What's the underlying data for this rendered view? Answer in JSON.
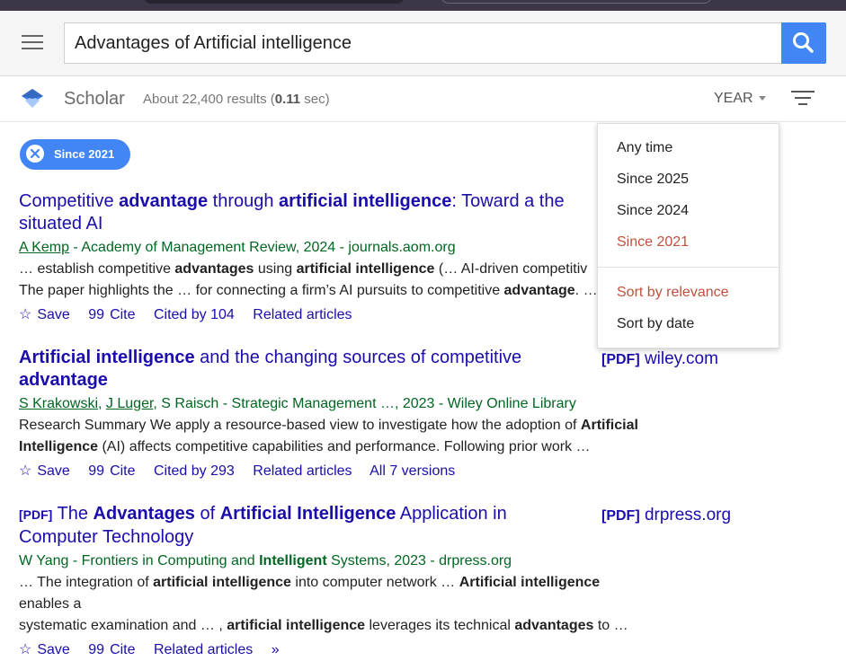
{
  "header": {
    "search_value": "Advantages of Artificial intelligence"
  },
  "subbar": {
    "brand": "Scholar",
    "stats_prefix": "About 22,400 results (",
    "stats_time": "0.11",
    "stats_suffix": " sec)",
    "year_label": "YEAR"
  },
  "chip": {
    "label": "Since 2021"
  },
  "dropdown": {
    "time_options": [
      "Any time",
      "Since 2025",
      "Since 2024",
      "Since 2021"
    ],
    "sort_options": [
      "Sort by relevance",
      "Sort by date"
    ],
    "selected_time": "Since 2021",
    "selected_sort": "Sort by relevance"
  },
  "results": [
    {
      "title_parts": [
        "Competitive ",
        "advantage",
        " through ",
        "artificial intelligence",
        ": Toward a the",
        "situated AI"
      ],
      "authors": "A Kemp",
      "source": " - Academy of Management Review, 2024 - journals.aom.org",
      "snippet_1": [
        "… establish competitive ",
        "advantages",
        " using ",
        "artificial intelligence",
        " (… AI-driven competitiv"
      ],
      "snippet_2": [
        "The paper highlights the … for connecting a firm’s AI pursuits to competitive ",
        "advantage",
        ". …"
      ],
      "save": "Save",
      "cite": "Cite",
      "cited_by": "Cited by 104",
      "related": "Related articles"
    },
    {
      "title_parts": [
        "Artificial intelligence",
        " and the changing sources of competitive ",
        "advantage"
      ],
      "authors_1": "S Krakowski",
      "authors_2": "J Luger",
      "authors_rest": ", S Raisch - Strategic Management …, 2023 - Wiley Online Library",
      "snippet_1": [
        "Research Summary We apply a resource-based view to investigate how the adoption of ",
        "Artificial"
      ],
      "snippet_2": [
        "Intelligence",
        " (AI) affects competitive capabilities and performance. Following prior work …"
      ],
      "save": "Save",
      "cite": "Cite",
      "cited_by": "Cited by 293",
      "related": "Related articles",
      "versions": "All 7 versions",
      "side_label": "[PDF]",
      "side_domain": "wiley.com"
    },
    {
      "pdf_tag": "[PDF]",
      "title_parts": [
        " The ",
        "Advantages",
        " of ",
        "Artificial Intelligence",
        " Application in",
        "Computer Technology"
      ],
      "authors": "W Yang - Frontiers in Computing and ",
      "authors_bold": "Intelligent",
      "authors_rest": " Systems, 2023 - drpress.org",
      "snippet_1": [
        "… The integration of ",
        "artificial intelligence",
        " into computer network … ",
        "Artificial intelligence",
        " enables a"
      ],
      "snippet_2": [
        "systematic examination and … , ",
        "artificial intelligence",
        " leverages its technical ",
        "advantages",
        " to …"
      ],
      "save": "Save",
      "cite": "Cite",
      "related": "Related articles",
      "side_label": "[PDF]",
      "side_domain": "drpress.org"
    }
  ],
  "icons": {
    "save": "☆",
    "cite": "99",
    "more": "»"
  },
  "colors": {
    "accent": "#4285f4",
    "link": "#1a0dab",
    "green": "#006621",
    "selected": "#c0503c"
  }
}
